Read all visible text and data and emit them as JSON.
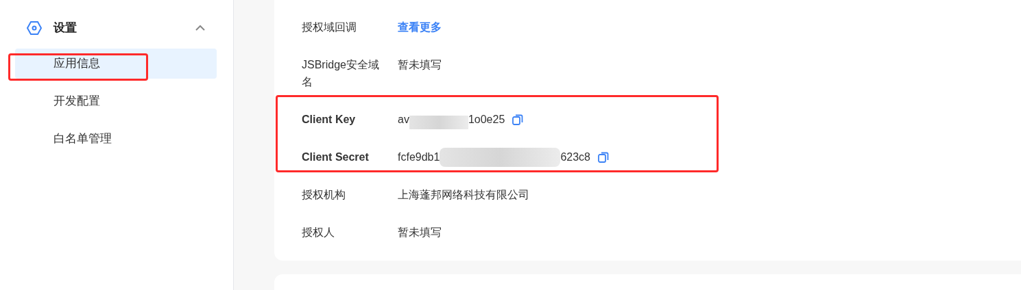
{
  "sidebar": {
    "group": {
      "label": "设置",
      "expanded": true
    },
    "items": [
      {
        "label": "应用信息",
        "selected": true,
        "annotated": true
      },
      {
        "label": "开发配置",
        "selected": false,
        "annotated": false
      },
      {
        "label": "白名单管理",
        "selected": false,
        "annotated": false
      }
    ]
  },
  "sections": [
    {
      "annotated": false,
      "fields": [
        {
          "kind": "link",
          "label": "授权域回调",
          "value": "查看更多"
        },
        {
          "kind": "text",
          "label": "JSBridge安全域名",
          "value": "暂未填写"
        }
      ]
    },
    {
      "annotated": true,
      "fields": [
        {
          "kind": "secret",
          "label": "Client Key",
          "value_start": "av",
          "value_end": "1o0e25"
        },
        {
          "kind": "secret",
          "label": "Client Secret",
          "value_start": "fcfe9db1",
          "value_end": "623c8"
        }
      ]
    },
    {
      "annotated": false,
      "fields": [
        {
          "kind": "text",
          "label": "授权机构",
          "value": "上海蓬邦网络科技有限公司"
        },
        {
          "kind": "text",
          "label": "授权人",
          "value": "暂未填写"
        }
      ]
    }
  ]
}
